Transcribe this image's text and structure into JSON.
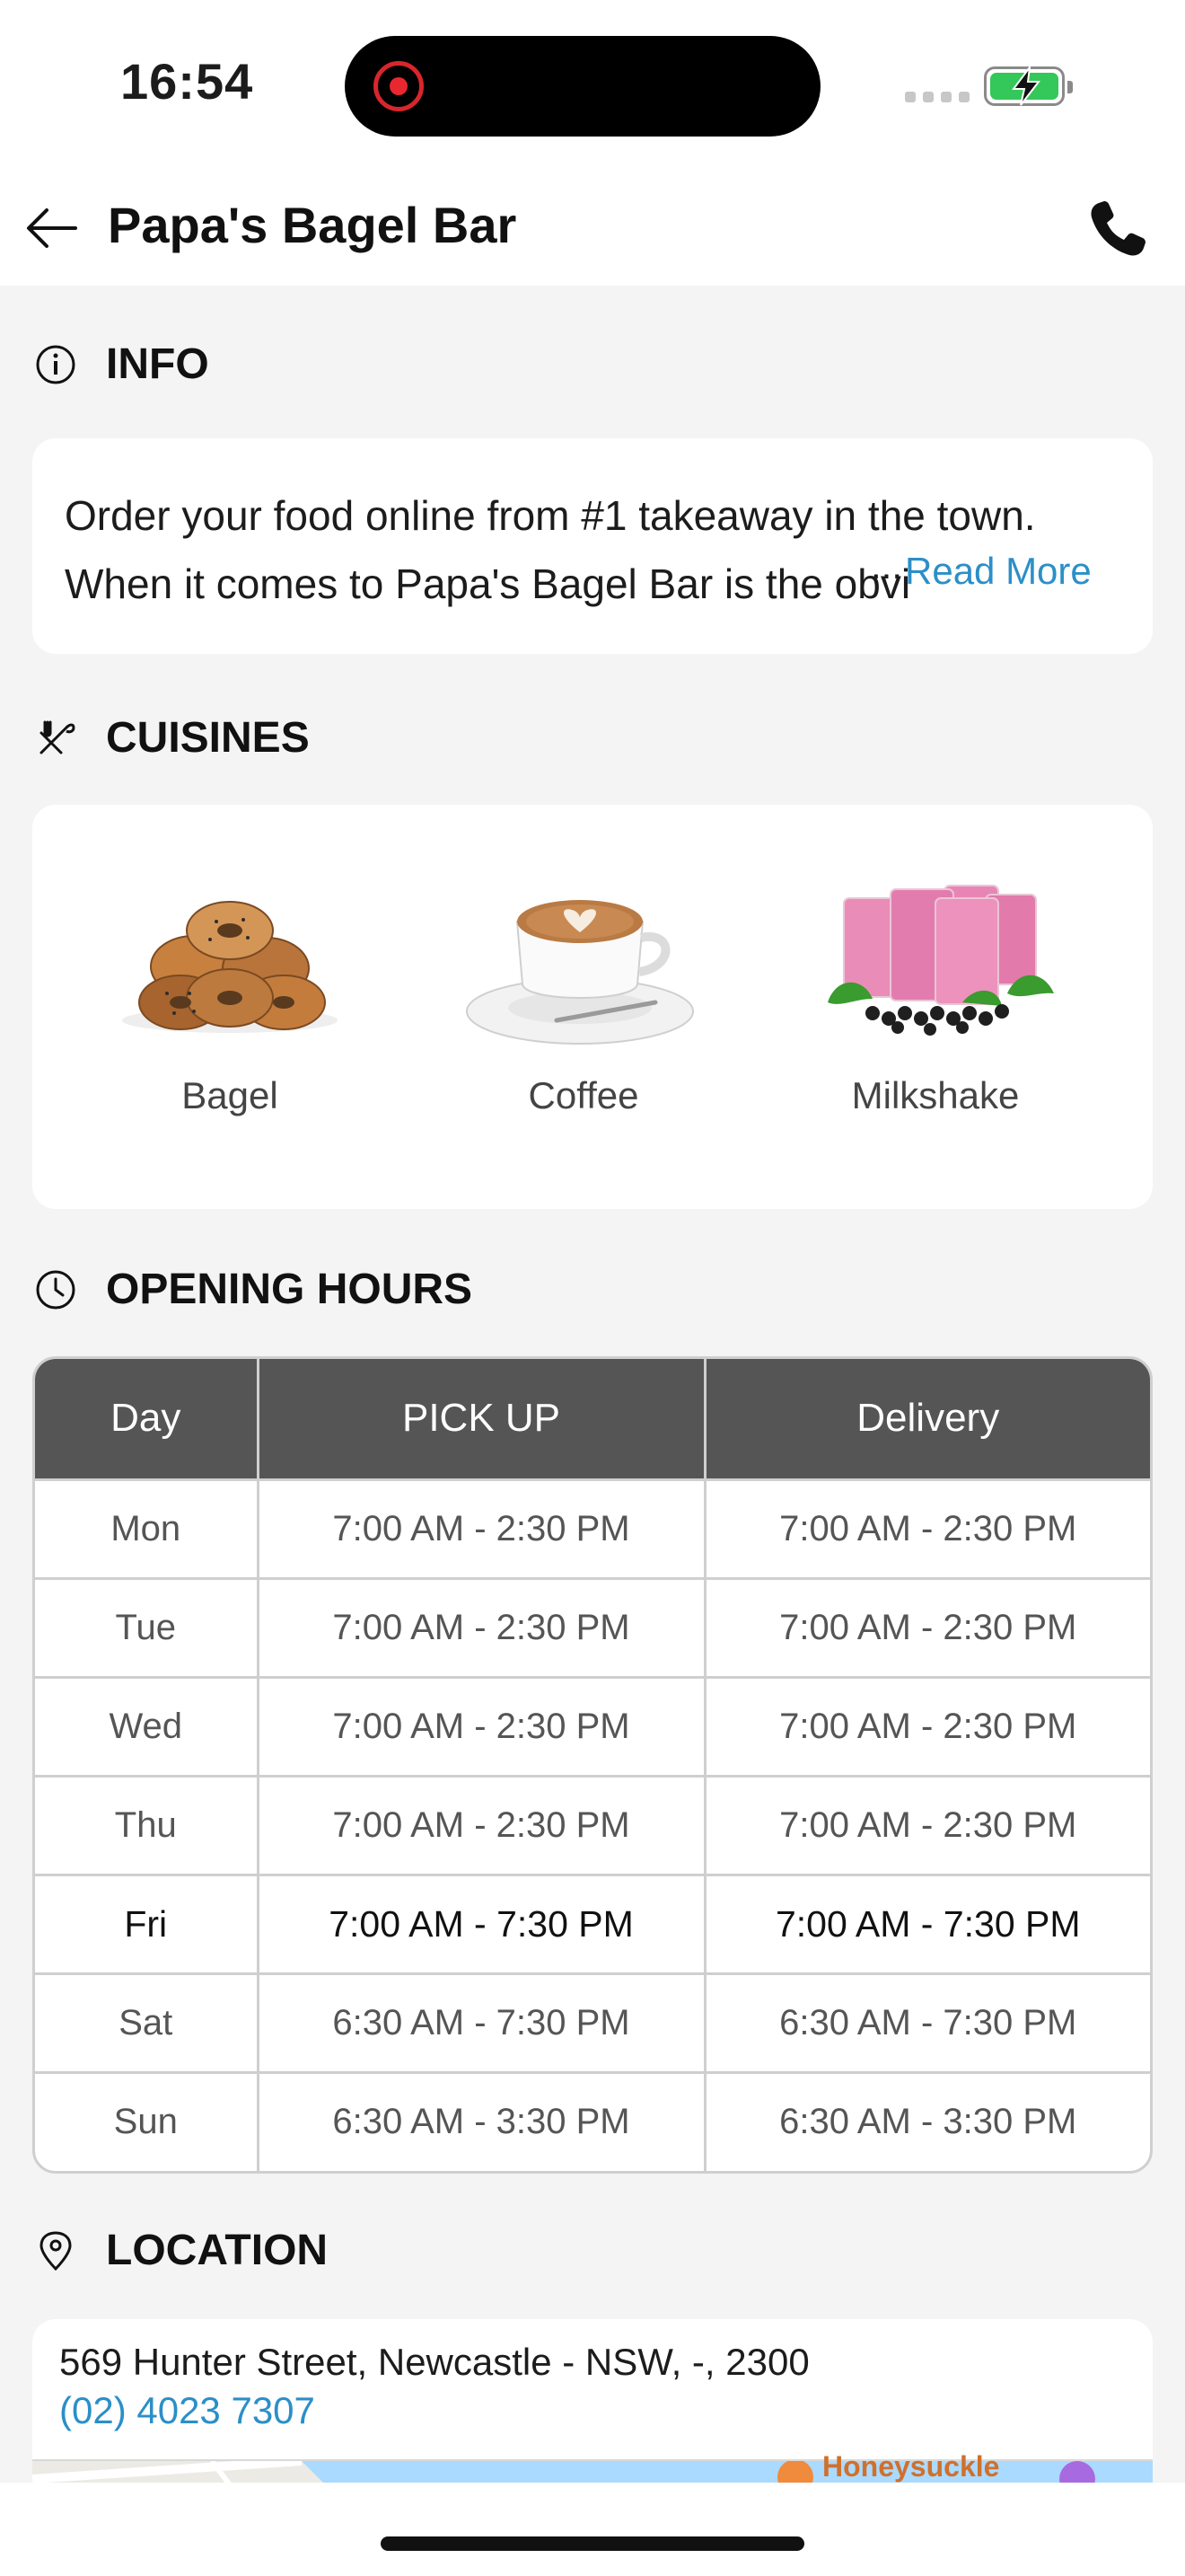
{
  "status_bar": {
    "time": "16:54"
  },
  "header": {
    "title": "Papa's Bagel Bar"
  },
  "info": {
    "heading": "INFO",
    "line1": "Order your food online from #1 takeaway in the town.",
    "line2": "When it comes to Papa's Bagel Bar is the obvious choice",
    "ellipsis": "...",
    "read_more": "Read More"
  },
  "cuisines": {
    "heading": "CUISINES",
    "items": [
      {
        "name": "Bagel"
      },
      {
        "name": "Coffee"
      },
      {
        "name": "Milkshake"
      }
    ]
  },
  "opening_hours": {
    "heading": "OPENING HOURS",
    "columns": [
      "Day",
      "PICK UP",
      "Delivery"
    ],
    "rows": [
      {
        "day": "Mon",
        "pickup": "7:00 AM - 2:30 PM",
        "delivery": "7:00 AM - 2:30 PM"
      },
      {
        "day": "Tue",
        "pickup": "7:00 AM - 2:30 PM",
        "delivery": "7:00 AM - 2:30 PM"
      },
      {
        "day": "Wed",
        "pickup": "7:00 AM - 2:30 PM",
        "delivery": "7:00 AM - 2:30 PM"
      },
      {
        "day": "Thu",
        "pickup": "7:00 AM - 2:30 PM",
        "delivery": "7:00 AM - 2:30 PM"
      },
      {
        "day": "Fri",
        "pickup": "7:00 AM - 7:30 PM",
        "delivery": "7:00 AM - 7:30 PM"
      },
      {
        "day": "Sat",
        "pickup": "6:30 AM - 7:30 PM",
        "delivery": "6:30 AM - 7:30 PM"
      },
      {
        "day": "Sun",
        "pickup": "6:30 AM - 3:30 PM",
        "delivery": "6:30 AM - 3:30 PM"
      }
    ]
  },
  "location": {
    "heading": "LOCATION",
    "address": "569 Hunter Street, Newcastle - NSW, -, 2300",
    "phone": "(02) 4023 7307",
    "map_label": "Honeysuckle"
  },
  "colors": {
    "accent_link": "#2b8fc8",
    "table_header": "#555555",
    "background": "#f4f4f4"
  },
  "icons": [
    "back-arrow-icon",
    "phone-icon",
    "info-icon",
    "utensils-icon",
    "clock-icon",
    "location-pin-icon"
  ]
}
